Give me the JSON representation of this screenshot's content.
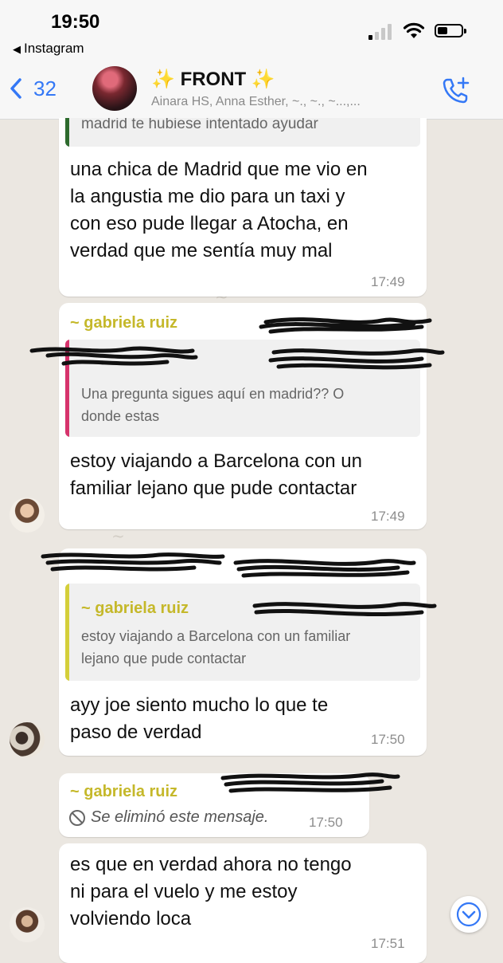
{
  "status_bar": {
    "time": "19:50",
    "back_app": "Instagram",
    "back_arrow": "◀"
  },
  "nav": {
    "back_count": "32",
    "group_name": "FRONT",
    "sparkle_left": "✨",
    "sparkle_right": "✨",
    "members": "Ainara HS, Anna Esther, ~., ~., ~...,..."
  },
  "messages": [
    {
      "id": "m1",
      "quote_partial": "madrid te hubiese intentado ayudar",
      "text": "una chica de Madrid que me vio en\nla angustia me dio para un taxi y\ncon eso pude llegar a Atocha, en\nverdad que me sentía muy mal",
      "time": "17:49"
    },
    {
      "id": "m2",
      "sender": "~ gabriela ruiz",
      "quote_text": "Una pregunta sigues aquí en madrid?? O\ndonde estas",
      "text": "estoy viajando a Barcelona con un\nfamiliar lejano que pude contactar",
      "time": "17:49"
    },
    {
      "id": "m3",
      "quote_sender": "~ gabriela ruiz",
      "quote_text": "estoy viajando a Barcelona con un familiar\nlejano que pude contactar",
      "text": "ayy joe siento mucho lo que te\npaso de verdad",
      "time": "17:50"
    },
    {
      "id": "m4",
      "sender": "~ gabriela ruiz",
      "deleted": "Se eliminó este mensaje.",
      "time": "17:50"
    },
    {
      "id": "m5",
      "text": "es que en verdad ahora no tengo\nni para el vuelo y me estoy\nvolviendo loca",
      "time": "17:51"
    }
  ],
  "colors": {
    "accent": "#3478f6",
    "sender": "#c5b82a",
    "quote_pink": "#d6336c",
    "quote_yellow": "#d4cf3a",
    "quote_green": "#2e6b2e"
  },
  "icons": {
    "back": "chevron-left-icon",
    "call": "phone-add-icon",
    "deleted": "block-icon",
    "scroll": "chevron-down-icon"
  }
}
